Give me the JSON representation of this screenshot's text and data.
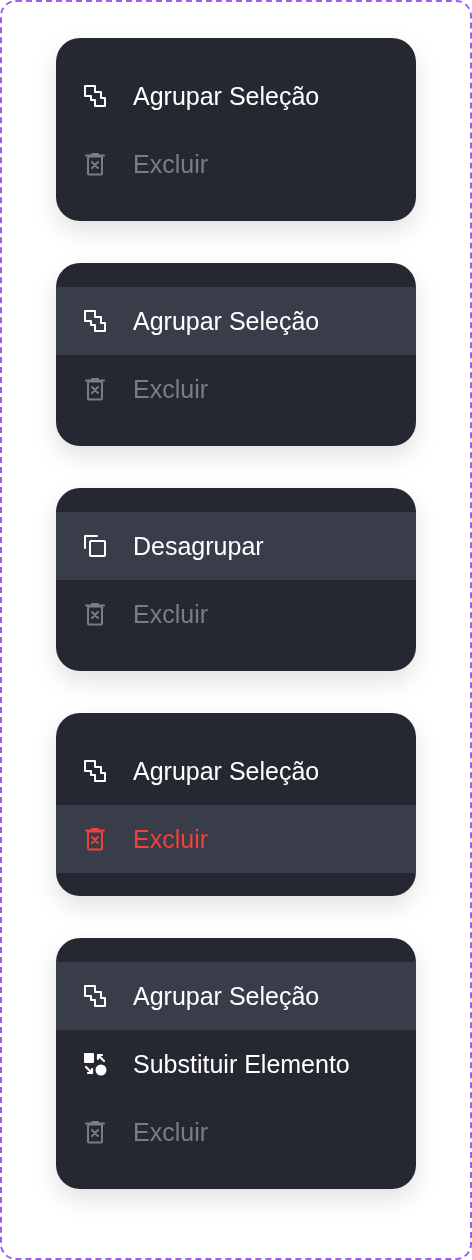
{
  "menus": [
    {
      "items": [
        {
          "kind": "group",
          "label": "Agrupar Seleção",
          "selected": false,
          "disabled": false
        },
        {
          "kind": "delete",
          "label": "Excluir",
          "selected": false,
          "disabled": true
        }
      ]
    },
    {
      "items": [
        {
          "kind": "group",
          "label": "Agrupar Seleção",
          "selected": true,
          "disabled": false
        },
        {
          "kind": "delete",
          "label": "Excluir",
          "selected": false,
          "disabled": true
        }
      ]
    },
    {
      "items": [
        {
          "kind": "ungroup",
          "label": "Desagrupar",
          "selected": true,
          "disabled": false
        },
        {
          "kind": "delete",
          "label": "Excluir",
          "selected": false,
          "disabled": true
        }
      ]
    },
    {
      "items": [
        {
          "kind": "group",
          "label": "Agrupar Seleção",
          "selected": false,
          "disabled": false
        },
        {
          "kind": "delete",
          "label": "Excluir",
          "selected": true,
          "disabled": false
        }
      ]
    },
    {
      "items": [
        {
          "kind": "group",
          "label": "Agrupar Seleção",
          "selected": true,
          "disabled": false
        },
        {
          "kind": "replace",
          "label": "Substituir Elemento",
          "selected": false,
          "disabled": false
        },
        {
          "kind": "delete",
          "label": "Excluir",
          "selected": false,
          "disabled": true
        }
      ]
    }
  ]
}
